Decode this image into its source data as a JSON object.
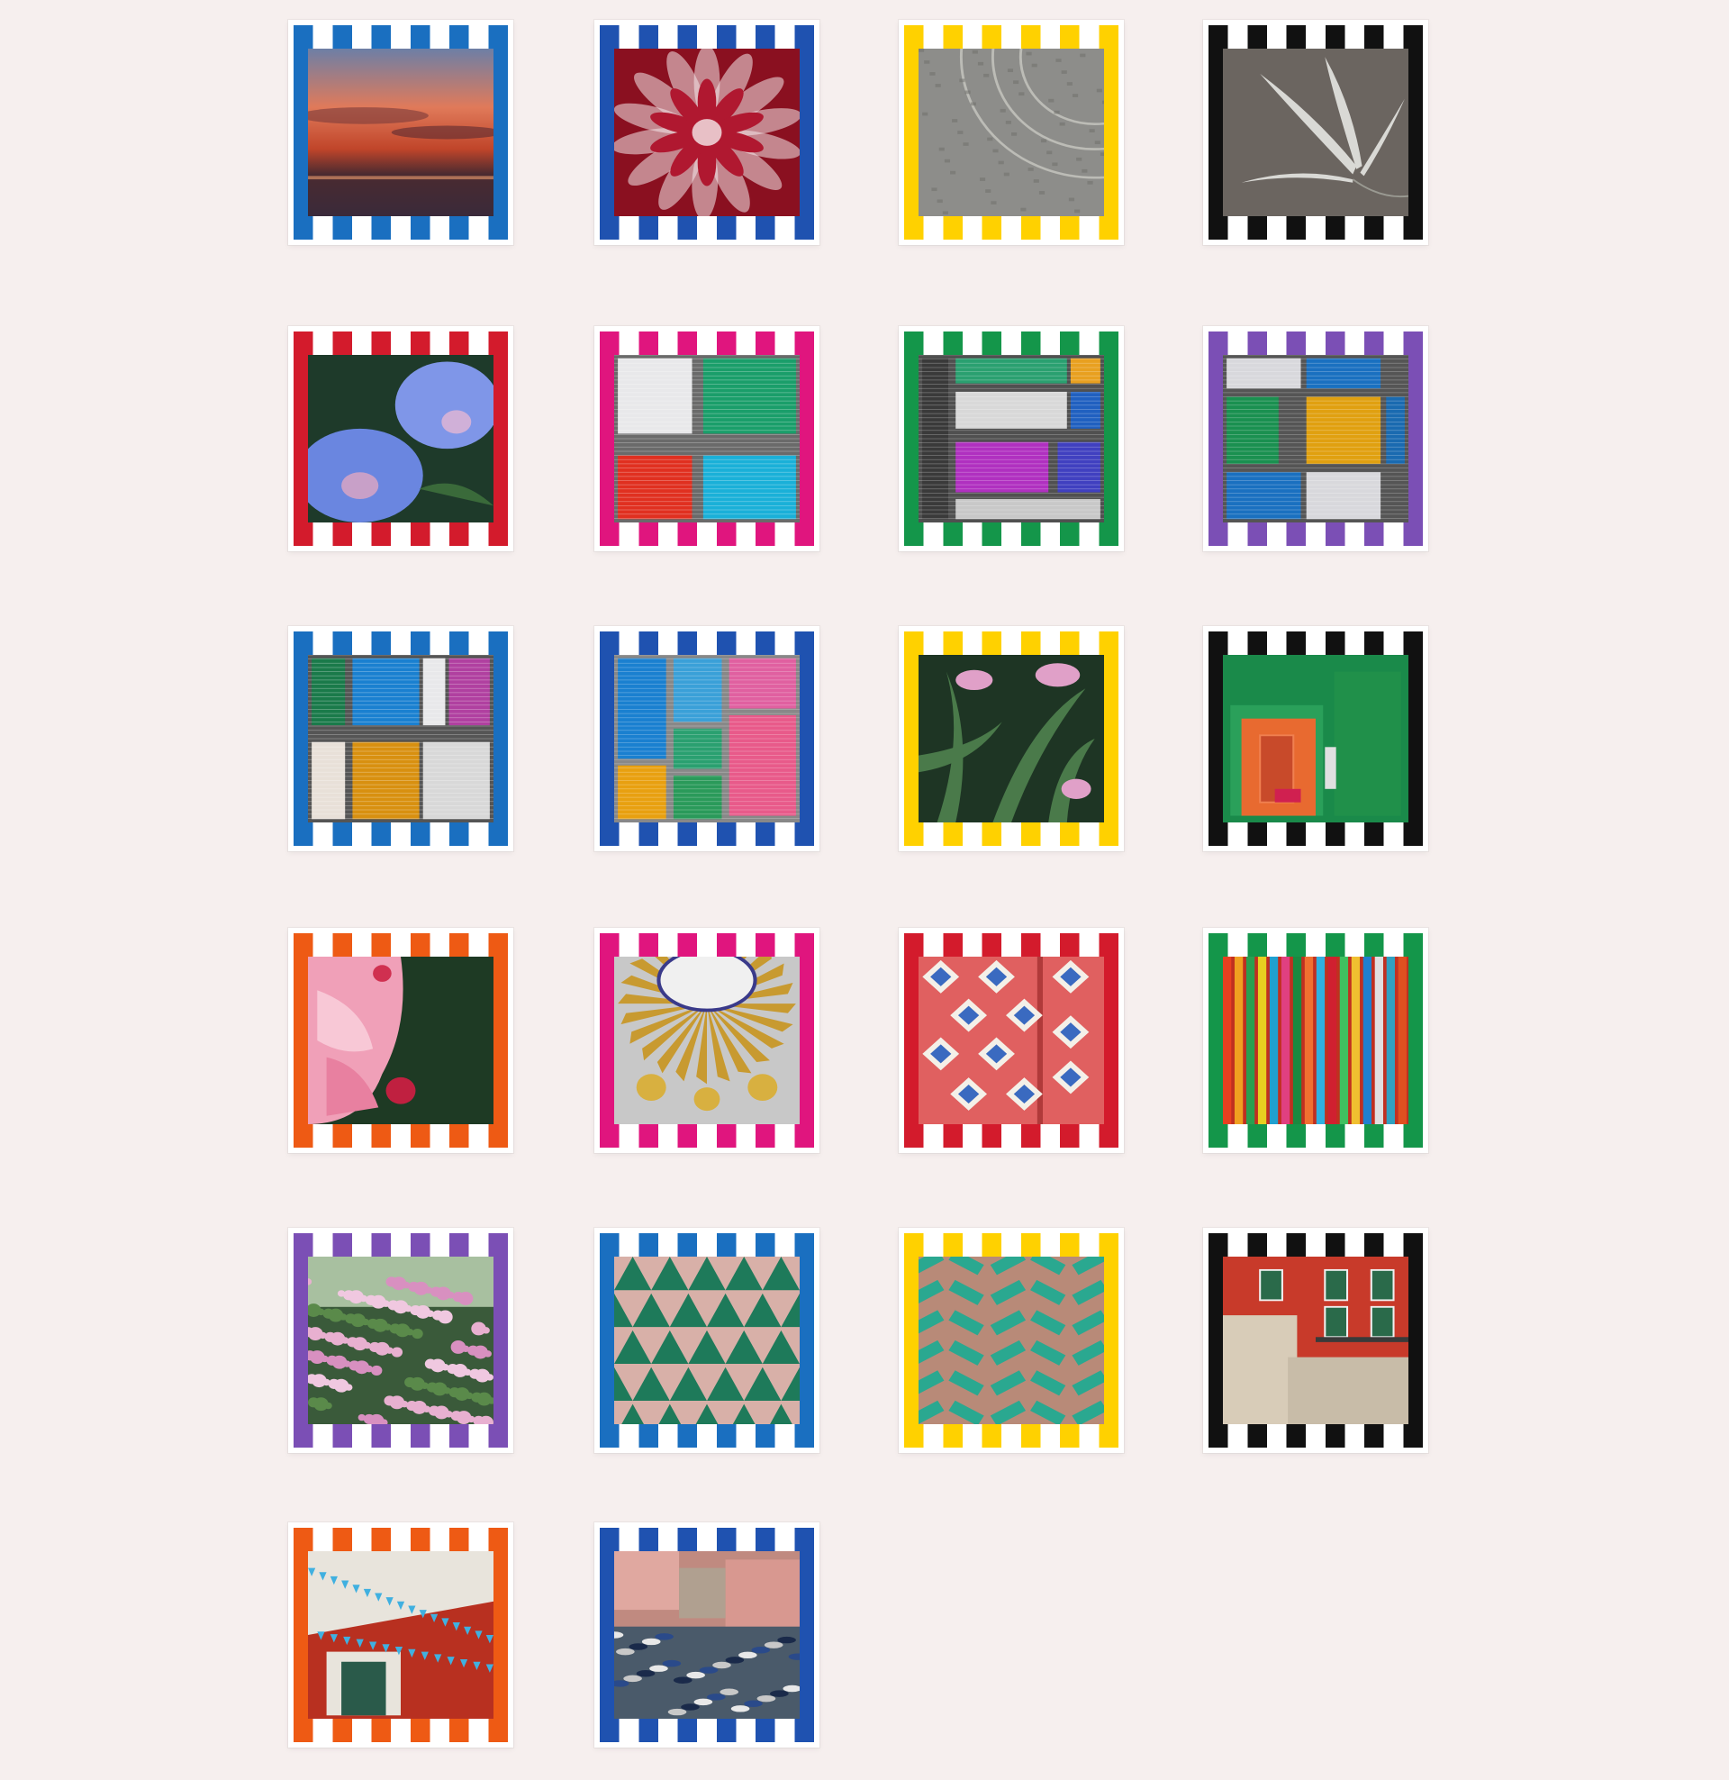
{
  "page": {
    "background": "#f6efee"
  },
  "gallery": {
    "scarves": [
      {
        "name": "sunset-scarf",
        "border_color": "#1a6fc0",
        "subject": "sunset"
      },
      {
        "name": "dahlia-scarf",
        "border_color": "#1f52b0",
        "subject": "dahlia"
      },
      {
        "name": "cobblestone-scarf",
        "border_color": "#ffd100",
        "subject": "cobblestone"
      },
      {
        "name": "white-lily-scarf",
        "border_color": "#111111",
        "subject": "lily-white"
      },
      {
        "name": "morning-glory-scarf",
        "border_color": "#d31b2c",
        "subject": "morning-glory"
      },
      {
        "name": "shutters-pink-scarf",
        "border_color": "#e0157e",
        "subject": "shutters-a"
      },
      {
        "name": "shutters-green-scarf",
        "border_color": "#14964a",
        "subject": "shutters-b"
      },
      {
        "name": "shutters-purple-scarf",
        "border_color": "#7b4fb5",
        "subject": "shutters-c"
      },
      {
        "name": "shutters-blue-scarf",
        "border_color": "#1a6fc0",
        "subject": "shutters-d"
      },
      {
        "name": "shutters-navy-scarf",
        "border_color": "#1f52b0",
        "subject": "shutters-e"
      },
      {
        "name": "lily-leaves-scarf",
        "border_color": "#ffd100",
        "subject": "lily-leaves"
      },
      {
        "name": "green-interior-scarf",
        "border_color": "#111111",
        "subject": "interior"
      },
      {
        "name": "pink-rose-scarf",
        "border_color": "#ee5a14",
        "subject": "rose"
      },
      {
        "name": "gilded-sunburst-scarf",
        "border_color": "#e0157e",
        "subject": "sunburst"
      },
      {
        "name": "red-tiles-scarf",
        "border_color": "#d31b2c",
        "subject": "tiles"
      },
      {
        "name": "color-stripes-scarf",
        "border_color": "#14964a",
        "subject": "stripes"
      },
      {
        "name": "pink-blossom-scarf",
        "border_color": "#7b4fb5",
        "subject": "blossom"
      },
      {
        "name": "triangle-tiles-scarf",
        "border_color": "#1a6fc0",
        "subject": "triangles"
      },
      {
        "name": "herringbone-tiles-scarf",
        "border_color": "#ffd100",
        "subject": "herringbone"
      },
      {
        "name": "red-facade-scarf",
        "border_color": "#111111",
        "subject": "facade"
      },
      {
        "name": "bunting-facade-scarf",
        "border_color": "#ee5a14",
        "subject": "bunting"
      },
      {
        "name": "harbor-scarf",
        "border_color": "#1f52b0",
        "subject": "harbor"
      }
    ]
  }
}
